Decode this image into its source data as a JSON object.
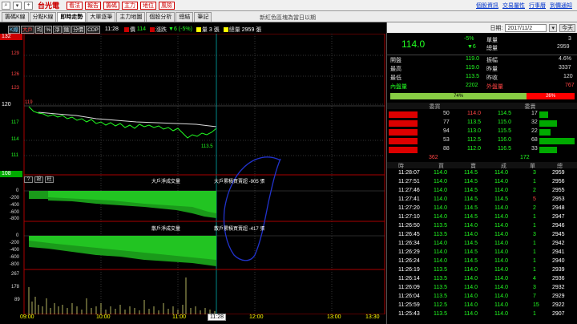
{
  "toolbar": {
    "symbol": "台光電",
    "buttons": [
      "看法",
      "報告",
      "籌碼",
      "主力",
      "地位",
      "風險"
    ],
    "links": [
      "個股資訊",
      "交易屬性",
      "行事曆",
      "到價通知"
    ]
  },
  "tabs": [
    "籌碼K線",
    "分點K線",
    "即時走勢",
    "大單逐筆",
    "主力地圖",
    "個股分析",
    "總結",
    "筆記"
  ],
  "notice": "新紅色區塊為當日以期",
  "info": {
    "options": [
      "K線",
      "大戶",
      "均",
      "%",
      "淨",
      "鑰",
      "分價",
      "CDP"
    ],
    "time": "11:28",
    "price_label": "價",
    "price": "114",
    "change_label": "漲跌",
    "change": "▼6 (-5%)",
    "vol_label": "量",
    "vol": "3 張",
    "total_label": "總量",
    "total": "2959 張"
  },
  "chart": {
    "price_axis": [
      "132",
      "129",
      "126",
      "123",
      "120",
      "117",
      "114",
      "111",
      "108"
    ],
    "price_line": [
      119.5,
      119.2,
      118.8,
      118.5,
      118.2,
      117.9,
      117.6,
      117.3,
      117.0,
      116.8,
      116.6,
      116.4,
      116.2,
      116.0,
      115.8
    ],
    "low_label": "113.5",
    "open_label": "119",
    "buy_axis": [
      "0",
      "-200",
      "-400",
      "-600",
      "-800"
    ],
    "big_label": "大戶淨成交量",
    "big_label2": "大戶累積買賣超 -905 張",
    "small_label": "散戶淨成交量",
    "small_label2": "散戶累積買賣超 -417 張",
    "vol_axis": [
      "267",
      "178",
      "89"
    ],
    "times": [
      "09:00",
      "10:00",
      "11:00",
      "12:00",
      "13:00",
      "13:30"
    ],
    "cursor": "11:28",
    "ctrl": [
      "?",
      "設",
      "柱"
    ]
  },
  "quote": {
    "date_label": "日期:",
    "date": "2017/11/2",
    "today": "今天",
    "price": "114.0",
    "pct": "-5%",
    "chg": "▼6",
    "unit_label": "單量",
    "unit": "3",
    "vol_label": "總量",
    "vol": "2959",
    "rows": [
      {
        "l1": "開盤",
        "v1": "119.0",
        "l2": "振幅",
        "v2": "4.6%",
        "c1": "g"
      },
      {
        "l1": "最高",
        "v1": "119.0",
        "l2": "昨量",
        "v2": "3337",
        "c1": "g"
      },
      {
        "l1": "最低",
        "v1": "113.5",
        "l2": "昨收",
        "v2": "120",
        "c1": "g"
      },
      {
        "l1": "內盤量",
        "v1": "2202",
        "l2": "外盤量",
        "v2": "767",
        "c1": "g"
      }
    ],
    "bar_in": "74%",
    "bar_out": "26%"
  },
  "orderbook": {
    "head": [
      "委買",
      "委賣"
    ],
    "rows": [
      {
        "bq": "50",
        "bp": "114.0",
        "ap": "114.5",
        "aq": "17"
      },
      {
        "bq": "77",
        "bp": "113.5",
        "ap": "115.0",
        "aq": "32"
      },
      {
        "bq": "94",
        "bp": "113.0",
        "ap": "115.5",
        "aq": "22"
      },
      {
        "bq": "53",
        "bp": "112.5",
        "ap": "116.0",
        "aq": "68"
      },
      {
        "bq": "88",
        "bp": "112.0",
        "ap": "116.5",
        "aq": "33"
      }
    ],
    "sum_bid": "362",
    "sum_ask": "172"
  },
  "ticks": {
    "head": [
      "時",
      "買",
      "賣",
      "成",
      "單",
      "總"
    ],
    "rows": [
      [
        "11:28:07",
        "114.0",
        "114.5",
        "114.0",
        "3",
        "2959"
      ],
      [
        "11:27:51",
        "114.0",
        "114.5",
        "114.0",
        "1",
        "2956"
      ],
      [
        "11:27:46",
        "114.0",
        "114.5",
        "114.0",
        "2",
        "2955"
      ],
      [
        "11:27:41",
        "114.0",
        "114.5",
        "114.5",
        "5",
        "2953"
      ],
      [
        "11:27:20",
        "114.0",
        "114.5",
        "114.0",
        "2",
        "2948"
      ],
      [
        "11:27:10",
        "114.0",
        "114.5",
        "114.0",
        "1",
        "2947"
      ],
      [
        "11:26:50",
        "113.5",
        "114.0",
        "114.0",
        "1",
        "2946"
      ],
      [
        "11:26:45",
        "113.5",
        "114.0",
        "114.0",
        "3",
        "2945"
      ],
      [
        "11:26:34",
        "114.0",
        "114.5",
        "114.0",
        "1",
        "2942"
      ],
      [
        "11:26:29",
        "114.0",
        "114.5",
        "114.0",
        "1",
        "2941"
      ],
      [
        "11:26:24",
        "114.0",
        "114.5",
        "114.0",
        "1",
        "2940"
      ],
      [
        "11:26:19",
        "113.5",
        "114.0",
        "114.0",
        "1",
        "2939"
      ],
      [
        "11:26:14",
        "113.5",
        "114.0",
        "114.0",
        "4",
        "2936"
      ],
      [
        "11:26:09",
        "113.5",
        "114.0",
        "114.0",
        "3",
        "2932"
      ],
      [
        "11:26:04",
        "113.5",
        "114.0",
        "114.0",
        "7",
        "2929"
      ],
      [
        "11:25:59",
        "112.5",
        "114.0",
        "114.0",
        "15",
        "2922"
      ],
      [
        "11:25:43",
        "113.5",
        "114.0",
        "114.0",
        "1",
        "2907"
      ]
    ]
  }
}
